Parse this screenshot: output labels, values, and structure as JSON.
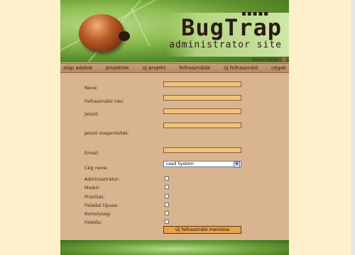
{
  "header": {
    "title": "BugTrap",
    "subtitle": "administrator site",
    "dots": "▪▪▪▪▪",
    "user_name": "Tamás Viktor",
    "logout_icon": "door-exit-icon"
  },
  "nav": {
    "items": [
      "alap adatok",
      "projektek",
      "új projekt",
      "felhasználók",
      "új felhasználó",
      "cégek"
    ]
  },
  "form": {
    "labels": {
      "name": "Neve:",
      "username": "Felhasználói név:",
      "password": "Jelszó:",
      "password_confirm": "Jelszó megerősítés:",
      "email": "Email:",
      "company": "Cég neve:",
      "admin": "Adminisztrátor:",
      "modul": "Modul:",
      "priority": "Prioritás:",
      "task_type": "Feladat típusa:",
      "severity": "Komolyság:",
      "responsible": "Felelős:"
    },
    "values": {
      "name": "",
      "username": "",
      "password": "",
      "password_confirm": "",
      "email": "",
      "company": "Lead System"
    },
    "submit_label": "Új felhasználó mentése"
  },
  "colors": {
    "page_bg": "#fdf0cb",
    "panel_bg": "#d8b48f",
    "input_bg": "#f1c27a",
    "button_bg": "#e8a34a"
  }
}
